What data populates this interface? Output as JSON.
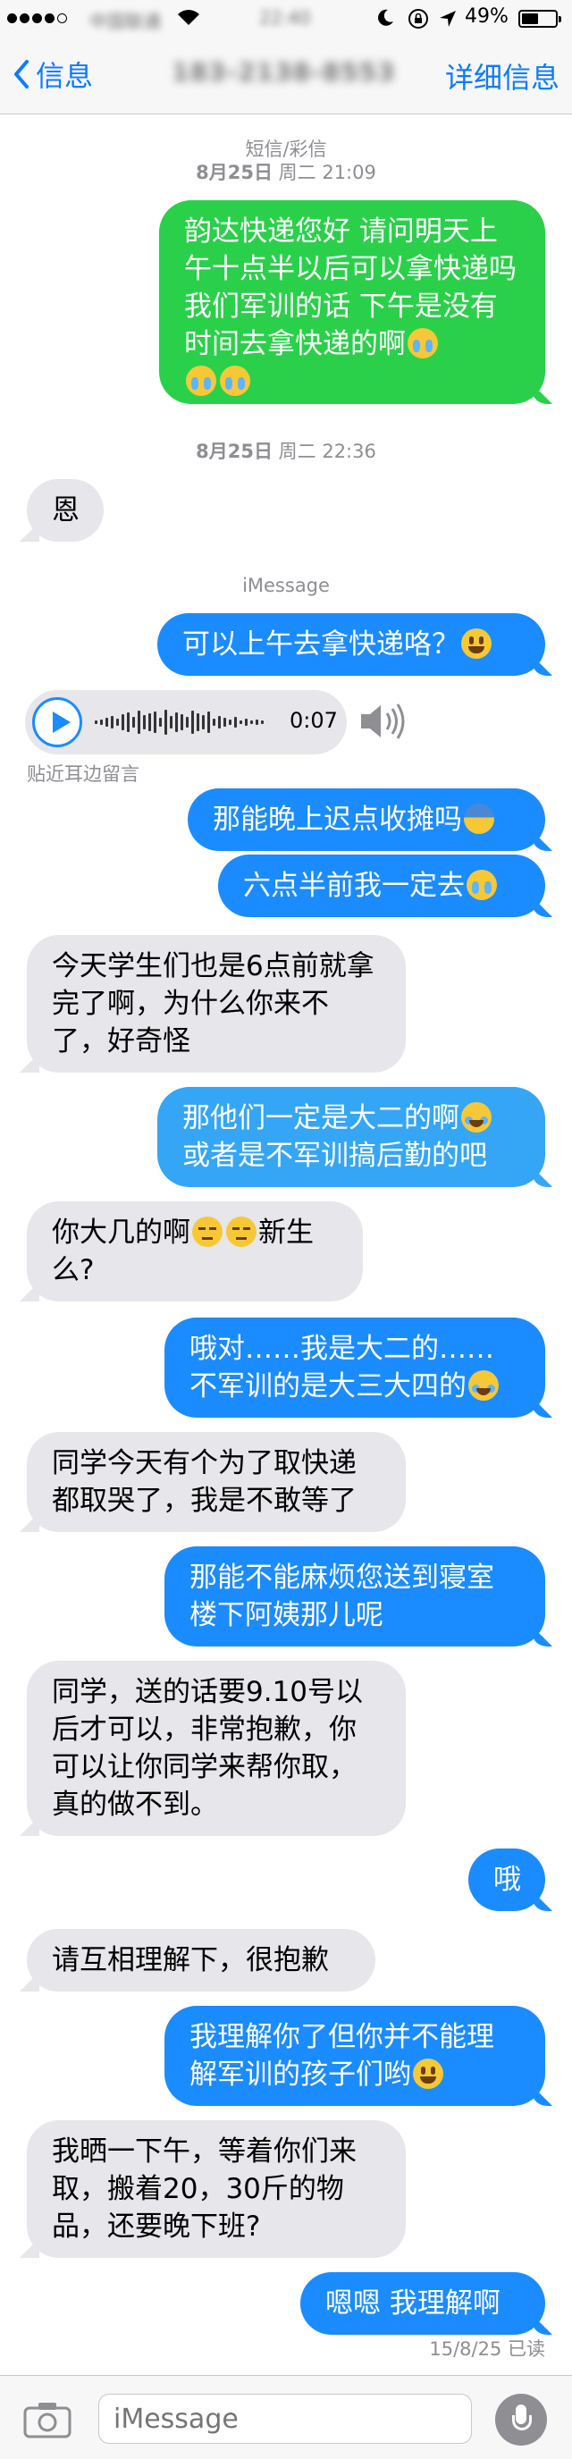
{
  "status_bar": {
    "carrier": "中国联通",
    "time": "22:40",
    "battery_percent": "49%",
    "battery_level": 0.49
  },
  "nav": {
    "back_label": "信息",
    "title": "183-2138-8553",
    "details_label": "详细信息"
  },
  "timestamps": {
    "sms_label": "短信/彩信",
    "first": {
      "date": "8月25日",
      "rest": " 周二 21:09"
    },
    "second": {
      "date": "8月25日",
      "rest": " 周二 22:36"
    },
    "imessage_label": "iMessage"
  },
  "messages": [
    {
      "id": "m1",
      "text": "韵达快递您好 请问明天上午十点半以后可以拿快递吗 我们军训的话 下午是没有时间去拿快递的啊",
      "emojis": [
        "cry",
        "cry",
        "cry"
      ],
      "direction": "out"
    },
    {
      "id": "m2",
      "text": "恩",
      "emojis": [],
      "direction": "in"
    },
    {
      "id": "m3",
      "text": "可以上午去拿快递咯？",
      "emojis": [
        "smile"
      ],
      "direction": "out"
    },
    {
      "id": "m4",
      "text": "那能晚上迟点收摊吗",
      "emojis": [
        "fear"
      ],
      "direction": "out"
    },
    {
      "id": "m5",
      "text": "六点半前我一定去",
      "emojis": [
        "cry"
      ],
      "direction": "out"
    },
    {
      "id": "m6",
      "text": "今天学生们也是6点前就拿完了啊，为什么你来不了，好奇怪",
      "emojis": [],
      "direction": "in"
    },
    {
      "id": "m7",
      "text": "那他们一定是大二的啊",
      "text2": "或者是不军训搞后勤的吧",
      "emojis": [
        "joy"
      ],
      "direction": "out"
    },
    {
      "id": "m8",
      "text": "你大几的啊",
      "text2": "新生么?",
      "emojis": [
        "unamused",
        "unamused"
      ],
      "direction": "in"
    },
    {
      "id": "m9",
      "text": "哦对……我是大二的……不军训的是大三大四的",
      "emojis": [
        "joy"
      ],
      "direction": "out"
    },
    {
      "id": "m10",
      "text": "同学今天有个为了取快递都取哭了，我是不敢等了",
      "emojis": [],
      "direction": "in"
    },
    {
      "id": "m11",
      "text": "那能不能麻烦您送到寝室楼下阿姨那儿呢",
      "emojis": [],
      "direction": "out"
    },
    {
      "id": "m12",
      "text": "同学，送的话要9.10号以后才可以，非常抱歉，你可以让你同学来帮你取，真的做不到。",
      "emojis": [],
      "direction": "in"
    },
    {
      "id": "m13",
      "text": "哦",
      "emojis": [],
      "direction": "out"
    },
    {
      "id": "m14",
      "text": "请互相理解下，很抱歉",
      "emojis": [],
      "direction": "in"
    },
    {
      "id": "m15",
      "text": "我理解你了但你并不能理解军训的孩子们哟",
      "emojis": [
        "smile"
      ],
      "direction": "out"
    },
    {
      "id": "m16",
      "text": "我晒一下午，等着你们来取，搬着20，30斤的物品，还要晚下班?",
      "emojis": [],
      "direction": "in"
    },
    {
      "id": "m17",
      "text": "嗯嗯 我理解啊",
      "emojis": [],
      "direction": "out"
    }
  ],
  "audio": {
    "duration": "0:07",
    "hint": "贴近耳边留言"
  },
  "receipt": "15/8/25 已读",
  "input": {
    "placeholder": "iMessage"
  },
  "colors": {
    "sms_green": "#2bd04a",
    "imessage_blue": "#1a8cff",
    "incoming_gray": "#e6e6eb",
    "accent": "#0a7cff"
  }
}
